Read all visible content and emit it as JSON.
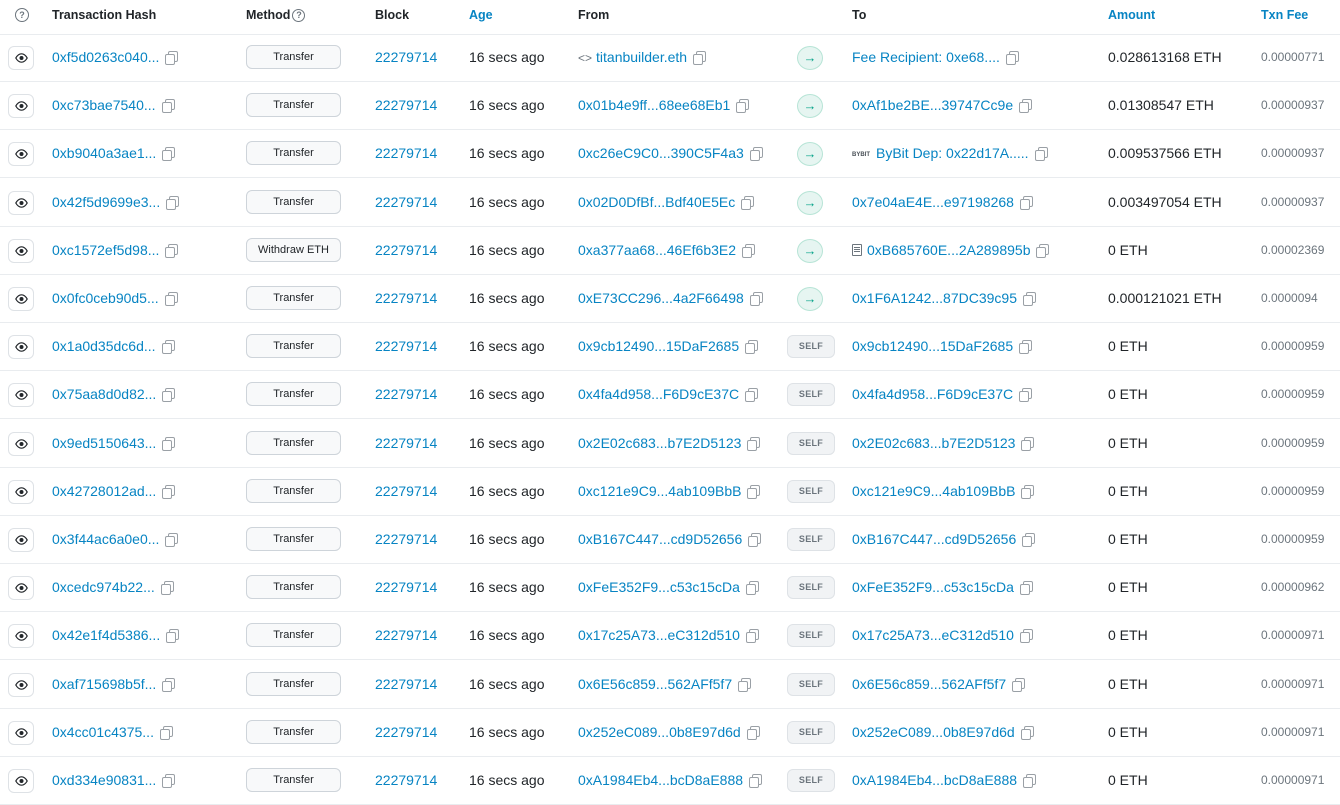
{
  "header": {
    "info_icon": "?",
    "hash": "Transaction Hash",
    "method": "Method",
    "block": "Block",
    "age": "Age",
    "from": "From",
    "to": "To",
    "amount": "Amount",
    "fee": "Txn Fee"
  },
  "self_label": "SELF",
  "rows": [
    {
      "hash": "0xf5d0263c040...",
      "method": "Transfer",
      "block": "22279714",
      "age": "16 secs ago",
      "from": "titanbuilder.eth",
      "from_icon": "code-icon",
      "dir": "arrow",
      "to": "Fee Recipient: 0xe68....",
      "to_icon": "",
      "amount": "0.028613168 ETH",
      "fee": "0.00000771"
    },
    {
      "hash": "0xc73bae7540...",
      "method": "Transfer",
      "block": "22279714",
      "age": "16 secs ago",
      "from": "0x01b4e9ff...68ee68Eb1",
      "from_icon": "",
      "dir": "arrow",
      "to": "0xAf1be2BE...39747Cc9e",
      "to_icon": "",
      "amount": "0.01308547 ETH",
      "fee": "0.00000937"
    },
    {
      "hash": "0xb9040a3ae1...",
      "method": "Transfer",
      "block": "22279714",
      "age": "16 secs ago",
      "from": "0xc26eC9C0...390C5F4a3",
      "from_icon": "",
      "dir": "arrow",
      "to": "ByBit Dep: 0x22d17A.....",
      "to_icon": "bybit-icon",
      "amount": "0.009537566 ETH",
      "fee": "0.00000937"
    },
    {
      "hash": "0x42f5d9699e3...",
      "method": "Transfer",
      "block": "22279714",
      "age": "16 secs ago",
      "from": "0x02D0DfBf...Bdf40E5Ec",
      "from_icon": "",
      "dir": "arrow",
      "to": "0x7e04aE4E...e97198268",
      "to_icon": "",
      "amount": "0.003497054 ETH",
      "fee": "0.00000937"
    },
    {
      "hash": "0xc1572ef5d98...",
      "method": "Withdraw ETH",
      "block": "22279714",
      "age": "16 secs ago",
      "from": "0xa377aa68...46Ef6b3E2",
      "from_icon": "",
      "dir": "arrow",
      "to": "0xB685760E...2A289895b",
      "to_icon": "contract-icon",
      "amount": "0 ETH",
      "fee": "0.00002369"
    },
    {
      "hash": "0x0fc0ceb90d5...",
      "method": "Transfer",
      "block": "22279714",
      "age": "16 secs ago",
      "from": "0xE73CC296...4a2F66498",
      "from_icon": "",
      "dir": "arrow",
      "to": "0x1F6A1242...87DC39c95",
      "to_icon": "",
      "amount": "0.000121021 ETH",
      "fee": "0.0000094"
    },
    {
      "hash": "0x1a0d35dc6d...",
      "method": "Transfer",
      "block": "22279714",
      "age": "16 secs ago",
      "from": "0x9cb12490...15DaF2685",
      "from_icon": "",
      "dir": "self",
      "to": "0x9cb12490...15DaF2685",
      "to_icon": "",
      "amount": "0 ETH",
      "fee": "0.00000959"
    },
    {
      "hash": "0x75aa8d0d82...",
      "method": "Transfer",
      "block": "22279714",
      "age": "16 secs ago",
      "from": "0x4fa4d958...F6D9cE37C",
      "from_icon": "",
      "dir": "self",
      "to": "0x4fa4d958...F6D9cE37C",
      "to_icon": "",
      "amount": "0 ETH",
      "fee": "0.00000959"
    },
    {
      "hash": "0x9ed5150643...",
      "method": "Transfer",
      "block": "22279714",
      "age": "16 secs ago",
      "from": "0x2E02c683...b7E2D5123",
      "from_icon": "",
      "dir": "self",
      "to": "0x2E02c683...b7E2D5123",
      "to_icon": "",
      "amount": "0 ETH",
      "fee": "0.00000959"
    },
    {
      "hash": "0x42728012ad...",
      "method": "Transfer",
      "block": "22279714",
      "age": "16 secs ago",
      "from": "0xc121e9C9...4ab109BbB",
      "from_icon": "",
      "dir": "self",
      "to": "0xc121e9C9...4ab109BbB",
      "to_icon": "",
      "amount": "0 ETH",
      "fee": "0.00000959"
    },
    {
      "hash": "0x3f44ac6a0e0...",
      "method": "Transfer",
      "block": "22279714",
      "age": "16 secs ago",
      "from": "0xB167C447...cd9D52656",
      "from_icon": "",
      "dir": "self",
      "to": "0xB167C447...cd9D52656",
      "to_icon": "",
      "amount": "0 ETH",
      "fee": "0.00000959"
    },
    {
      "hash": "0xcedc974b22...",
      "method": "Transfer",
      "block": "22279714",
      "age": "16 secs ago",
      "from": "0xFeE352F9...c53c15cDa",
      "from_icon": "",
      "dir": "self",
      "to": "0xFeE352F9...c53c15cDa",
      "to_icon": "",
      "amount": "0 ETH",
      "fee": "0.00000962"
    },
    {
      "hash": "0x42e1f4d5386...",
      "method": "Transfer",
      "block": "22279714",
      "age": "16 secs ago",
      "from": "0x17c25A73...eC312d510",
      "from_icon": "",
      "dir": "self",
      "to": "0x17c25A73...eC312d510",
      "to_icon": "",
      "amount": "0 ETH",
      "fee": "0.00000971"
    },
    {
      "hash": "0xaf715698b5f...",
      "method": "Transfer",
      "block": "22279714",
      "age": "16 secs ago",
      "from": "0x6E56c859...562AFf5f7",
      "from_icon": "",
      "dir": "self",
      "to": "0x6E56c859...562AFf5f7",
      "to_icon": "",
      "amount": "0 ETH",
      "fee": "0.00000971"
    },
    {
      "hash": "0x4cc01c4375...",
      "method": "Transfer",
      "block": "22279714",
      "age": "16 secs ago",
      "from": "0x252eC089...0b8E97d6d",
      "from_icon": "",
      "dir": "self",
      "to": "0x252eC089...0b8E97d6d",
      "to_icon": "",
      "amount": "0 ETH",
      "fee": "0.00000971"
    },
    {
      "hash": "0xd334e90831...",
      "method": "Transfer",
      "block": "22279714",
      "age": "16 secs ago",
      "from": "0xA1984Eb4...bcD8aE888",
      "from_icon": "",
      "dir": "self",
      "to": "0xA1984Eb4...bcD8aE888",
      "to_icon": "",
      "amount": "0 ETH",
      "fee": "0.00000971"
    }
  ],
  "colors": {
    "link": "#0784c3",
    "arrow_bg": "#e6f5f1",
    "arrow_fg": "#00a186",
    "border": "#e9ecef"
  }
}
